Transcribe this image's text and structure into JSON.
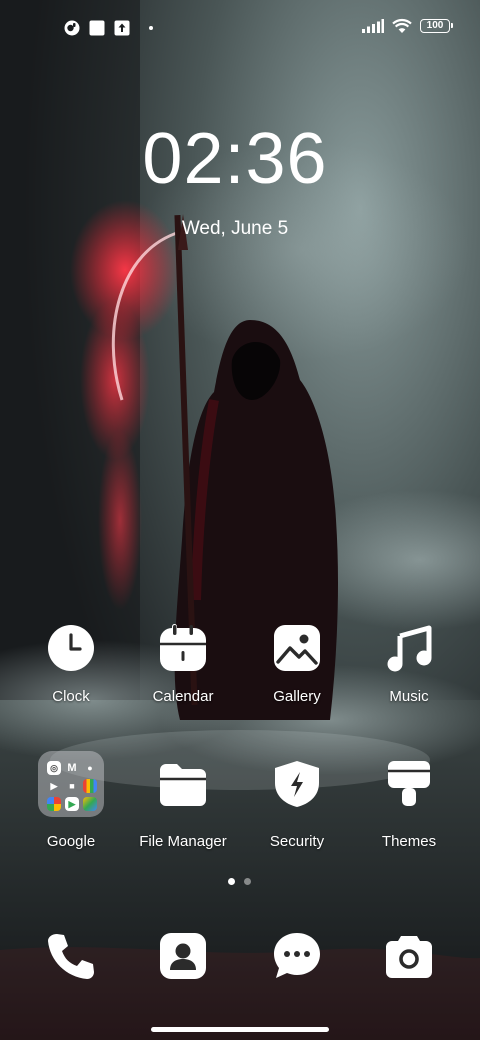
{
  "status_bar": {
    "battery": "100",
    "icons": [
      "notification-app-icon",
      "square-notification-icon",
      "upload-icon",
      "dot-icon",
      "signal-icon",
      "wifi-icon",
      "battery-icon"
    ]
  },
  "lock_clock": {
    "time": "02:36",
    "date": "Wed, June 5"
  },
  "home": {
    "row1": [
      {
        "label": "Clock",
        "icon": "clock-icon"
      },
      {
        "label": "Calendar",
        "icon": "calendar-icon"
      },
      {
        "label": "Gallery",
        "icon": "gallery-icon"
      },
      {
        "label": "Music",
        "icon": "music-icon"
      }
    ],
    "row2": [
      {
        "label": "Google",
        "icon": "google-folder-icon"
      },
      {
        "label": "File Manager",
        "icon": "folder-icon"
      },
      {
        "label": "Security",
        "icon": "shield-icon"
      },
      {
        "label": "Themes",
        "icon": "paint-brush-icon"
      }
    ],
    "dock": [
      {
        "icon": "phone-icon"
      },
      {
        "icon": "contacts-icon"
      },
      {
        "icon": "messages-icon"
      },
      {
        "icon": "camera-icon"
      }
    ],
    "page_indicator": {
      "pages": 2,
      "active": 1
    }
  },
  "colors": {
    "icon": "#ffffff",
    "accent_red": "#ff3040"
  }
}
